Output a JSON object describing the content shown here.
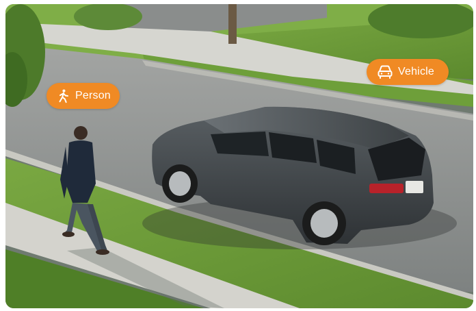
{
  "badges": {
    "person": {
      "label": "Person",
      "icon": "walking-person-icon"
    },
    "vehicle": {
      "label": "Vehicle",
      "icon": "car-front-icon"
    }
  },
  "colors": {
    "badge_background": "#f08a24",
    "badge_text": "#ffffff",
    "lawn": "#6d9a3b",
    "road": "#8f9291",
    "sidewalk": "#cfcfc9",
    "car_body": "#3f4447"
  }
}
